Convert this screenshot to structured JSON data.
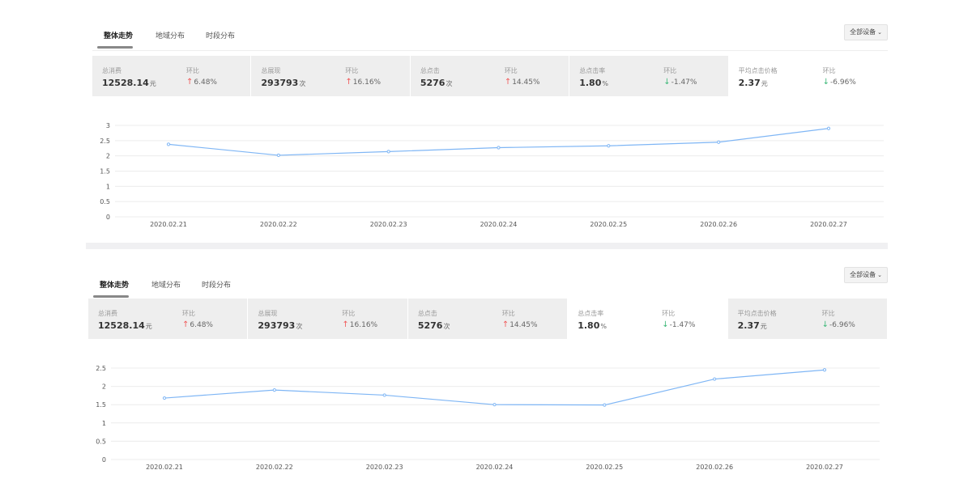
{
  "panels": [
    {
      "tabs": [
        "整体走势",
        "地域分布",
        "时段分布"
      ],
      "device_select": "全部设备",
      "metrics": [
        {
          "name": "总消费",
          "value": "12528.14",
          "unit": "元",
          "compare_label": "环比",
          "change": "6.48%",
          "direction": "up"
        },
        {
          "name": "总展现",
          "value": "293793",
          "unit": "次",
          "compare_label": "环比",
          "change": "16.16%",
          "direction": "up"
        },
        {
          "name": "总点击",
          "value": "5276",
          "unit": "次",
          "compare_label": "环比",
          "change": "14.45%",
          "direction": "up"
        },
        {
          "name": "总点击率",
          "value": "1.80",
          "unit": "%",
          "compare_label": "环比",
          "change": "-1.47%",
          "direction": "down"
        },
        {
          "name": "平均点击价格",
          "value": "2.37",
          "unit": "元",
          "compare_label": "环比",
          "change": "-6.96%",
          "direction": "down"
        }
      ],
      "selected_metric": 4
    },
    {
      "tabs": [
        "整体走势",
        "地域分布",
        "时段分布"
      ],
      "device_select": "全部设备",
      "metrics": [
        {
          "name": "总消费",
          "value": "12528.14",
          "unit": "元",
          "compare_label": "环比",
          "change": "6.48%",
          "direction": "up"
        },
        {
          "name": "总展现",
          "value": "293793",
          "unit": "次",
          "compare_label": "环比",
          "change": "16.16%",
          "direction": "up"
        },
        {
          "name": "总点击",
          "value": "5276",
          "unit": "次",
          "compare_label": "环比",
          "change": "14.45%",
          "direction": "up"
        },
        {
          "name": "总点击率",
          "value": "1.80",
          "unit": "%",
          "compare_label": "环比",
          "change": "-1.47%",
          "direction": "down"
        },
        {
          "name": "平均点击价格",
          "value": "2.37",
          "unit": "元",
          "compare_label": "环比",
          "change": "-6.96%",
          "direction": "down"
        }
      ],
      "selected_metric": 3
    }
  ],
  "colors": {
    "line": "#7fb6f5",
    "up_arrow": "#f05a5a",
    "down_arrow": "#3cb878",
    "grid": "#ececec",
    "metric_bg": "#eeeeee"
  },
  "chart_data": [
    {
      "type": "line",
      "x": [
        "2020.02.21",
        "2020.02.22",
        "2020.02.23",
        "2020.02.24",
        "2020.02.25",
        "2020.02.26",
        "2020.02.27"
      ],
      "series": [
        {
          "values": [
            2.38,
            2.02,
            2.14,
            2.27,
            2.33,
            2.45,
            2.9
          ]
        }
      ],
      "yticks": [
        "0",
        "0.5",
        "1",
        "1.5",
        "2",
        "2.5",
        "3"
      ],
      "ylim": [
        0,
        3
      ],
      "grid": true
    },
    {
      "type": "line",
      "x": [
        "2020.02.21",
        "2020.02.22",
        "2020.02.23",
        "2020.02.24",
        "2020.02.25",
        "2020.02.26",
        "2020.02.27"
      ],
      "series": [
        {
          "values": [
            1.68,
            1.9,
            1.76,
            1.5,
            1.49,
            2.2,
            2.45
          ]
        }
      ],
      "yticks": [
        "0",
        "0.5",
        "1",
        "1.5",
        "2",
        "2.5"
      ],
      "ylim": [
        0,
        2.5
      ],
      "grid": true
    }
  ]
}
